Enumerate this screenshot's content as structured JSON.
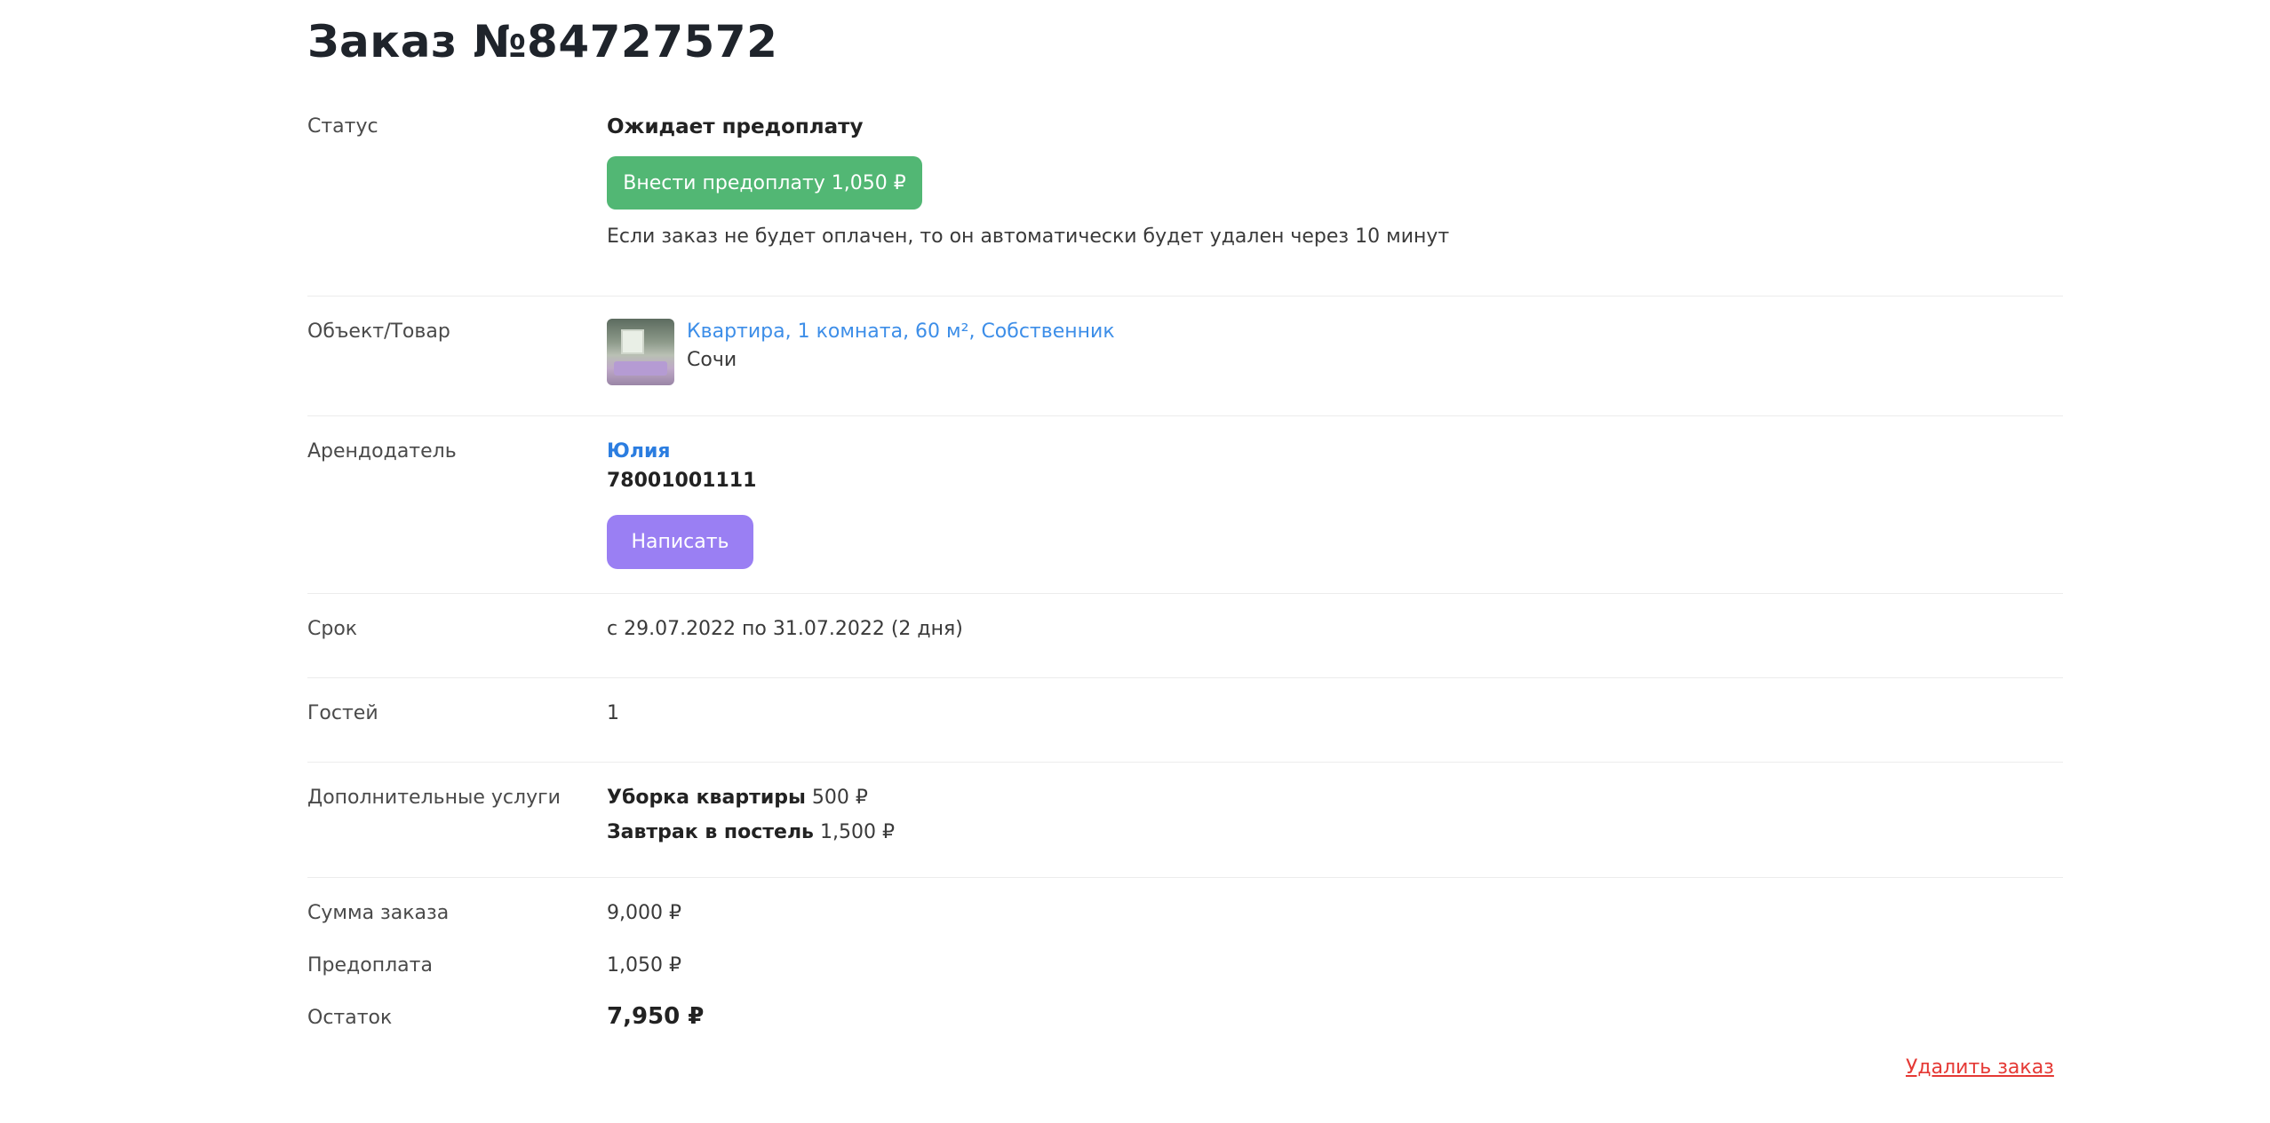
{
  "order": {
    "title": "Заказ №84727572"
  },
  "status": {
    "label": "Статус",
    "value": "Ожидает предоплату",
    "pay_button": "Внести предоплату 1,050 ₽",
    "note": "Если заказ не будет оплачен, то он автоматически будет удален через 10 минут"
  },
  "object": {
    "label": "Объект/Товар",
    "thumbnail_icon": "apartment-photo",
    "title": "Квартира, 1 комната, 60 м², Собственник",
    "city": "Сочи"
  },
  "landlord": {
    "label": "Арендодатель",
    "name": "Юлия",
    "phone": "78001001111",
    "write_button": "Написать"
  },
  "period": {
    "label": "Срок",
    "value": "с 29.07.2022 по 31.07.2022 (2 дня)"
  },
  "guests": {
    "label": "Гостей",
    "value": "1"
  },
  "services": {
    "label": "Дополнительные услуги",
    "items": [
      {
        "name": "Уборка квартиры",
        "price": "500 ₽"
      },
      {
        "name": "Завтрак в постель",
        "price": "1,500 ₽"
      }
    ]
  },
  "totals": {
    "sum_label": "Сумма заказа",
    "sum_value": "9,000 ₽",
    "prepay_label": "Предоплата",
    "prepay_value": "1,050 ₽",
    "remain_label": "Остаток",
    "remain_value": "7,950 ₽"
  },
  "actions": {
    "delete": "Удалить заказ"
  },
  "colors": {
    "pay_button": "#52b774",
    "write_button": "#9a7ff3",
    "link": "#3d8ee8",
    "danger": "#e53935"
  }
}
